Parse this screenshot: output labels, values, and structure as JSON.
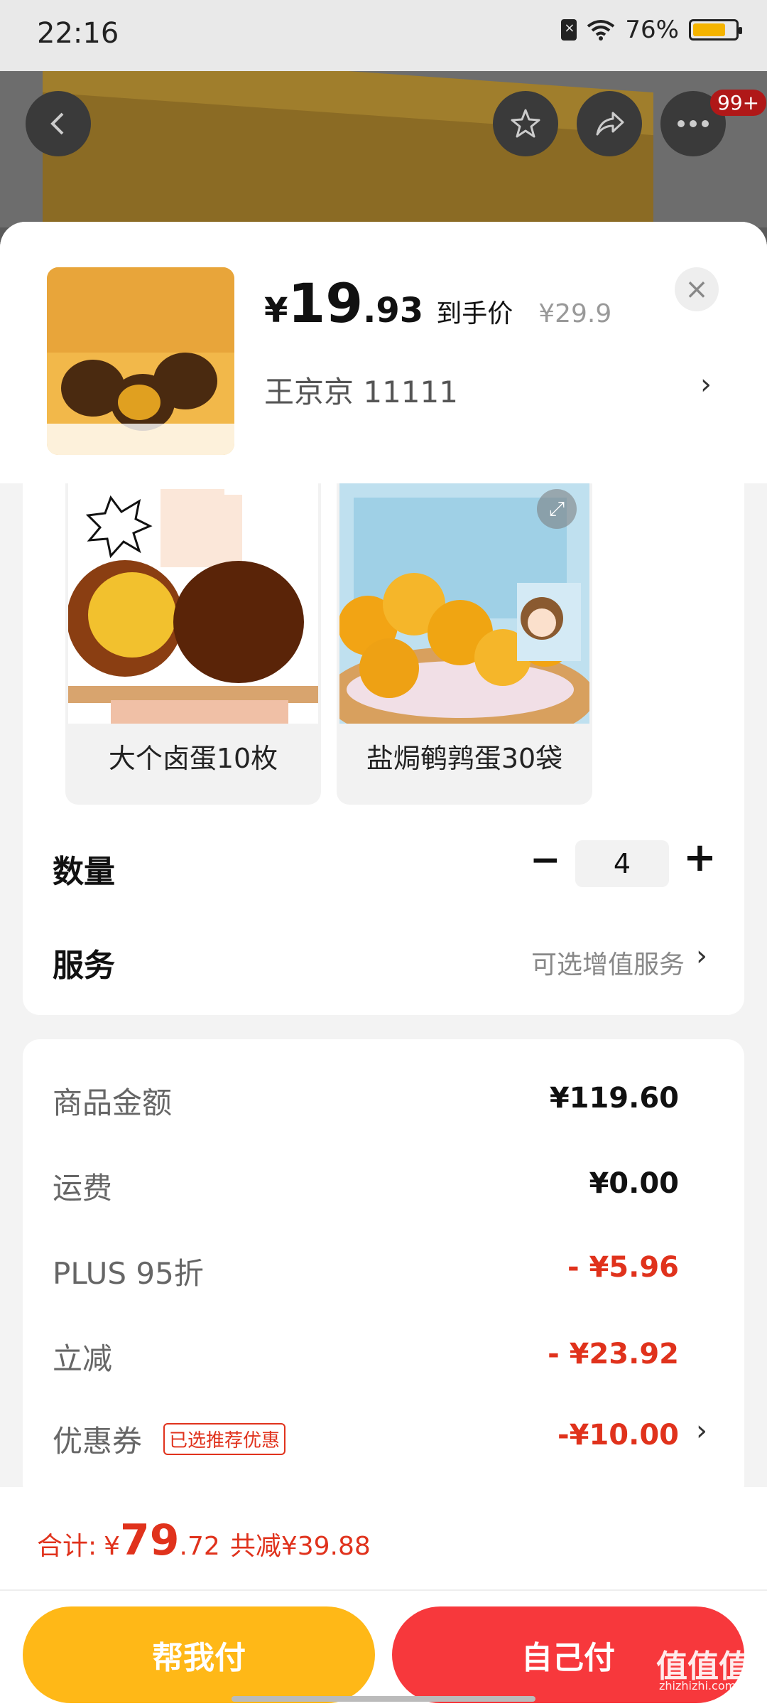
{
  "status_bar": {
    "time": "22:16",
    "battery_percent": "76%",
    "battery_level": 0.76
  },
  "top_nav": {
    "cart_badge": "99+"
  },
  "product": {
    "price_symbol": "¥",
    "price_int": "19",
    "price_dec": ".93",
    "price_label": "到手价",
    "original_price": "¥29.9",
    "address": "王京京  11111"
  },
  "options": [
    {
      "label": "大个卤蛋10枚"
    },
    {
      "label": "盐焗鹌鹑蛋30袋"
    }
  ],
  "quantity": {
    "label": "数量",
    "value": "4"
  },
  "service": {
    "label": "服务",
    "value": "可选增值服务"
  },
  "summary": {
    "rows": [
      {
        "label": "商品金额",
        "value": "¥119.60"
      },
      {
        "label": "运费",
        "value": "¥0.00"
      },
      {
        "label": "PLUS 95折",
        "value": "- ¥5.96"
      },
      {
        "label": "立减",
        "value": "- ¥23.92"
      },
      {
        "label": "优惠券",
        "value": "-¥10.00"
      }
    ],
    "coupon_tag": "已选推荐优惠"
  },
  "footer": {
    "total_label": "合计:",
    "total_symbol": "¥",
    "total_int": "79",
    "total_dec": ".72",
    "total_saved": "共减¥39.88",
    "help_pay": "帮我付",
    "self_pay": "自己付"
  },
  "watermark": {
    "main": "值值值",
    "sub": "zhizhizhi.com"
  },
  "colors": {
    "accent_red": "#e0321c",
    "help_pay": "#ffb817",
    "self_pay": "#f7383c"
  }
}
